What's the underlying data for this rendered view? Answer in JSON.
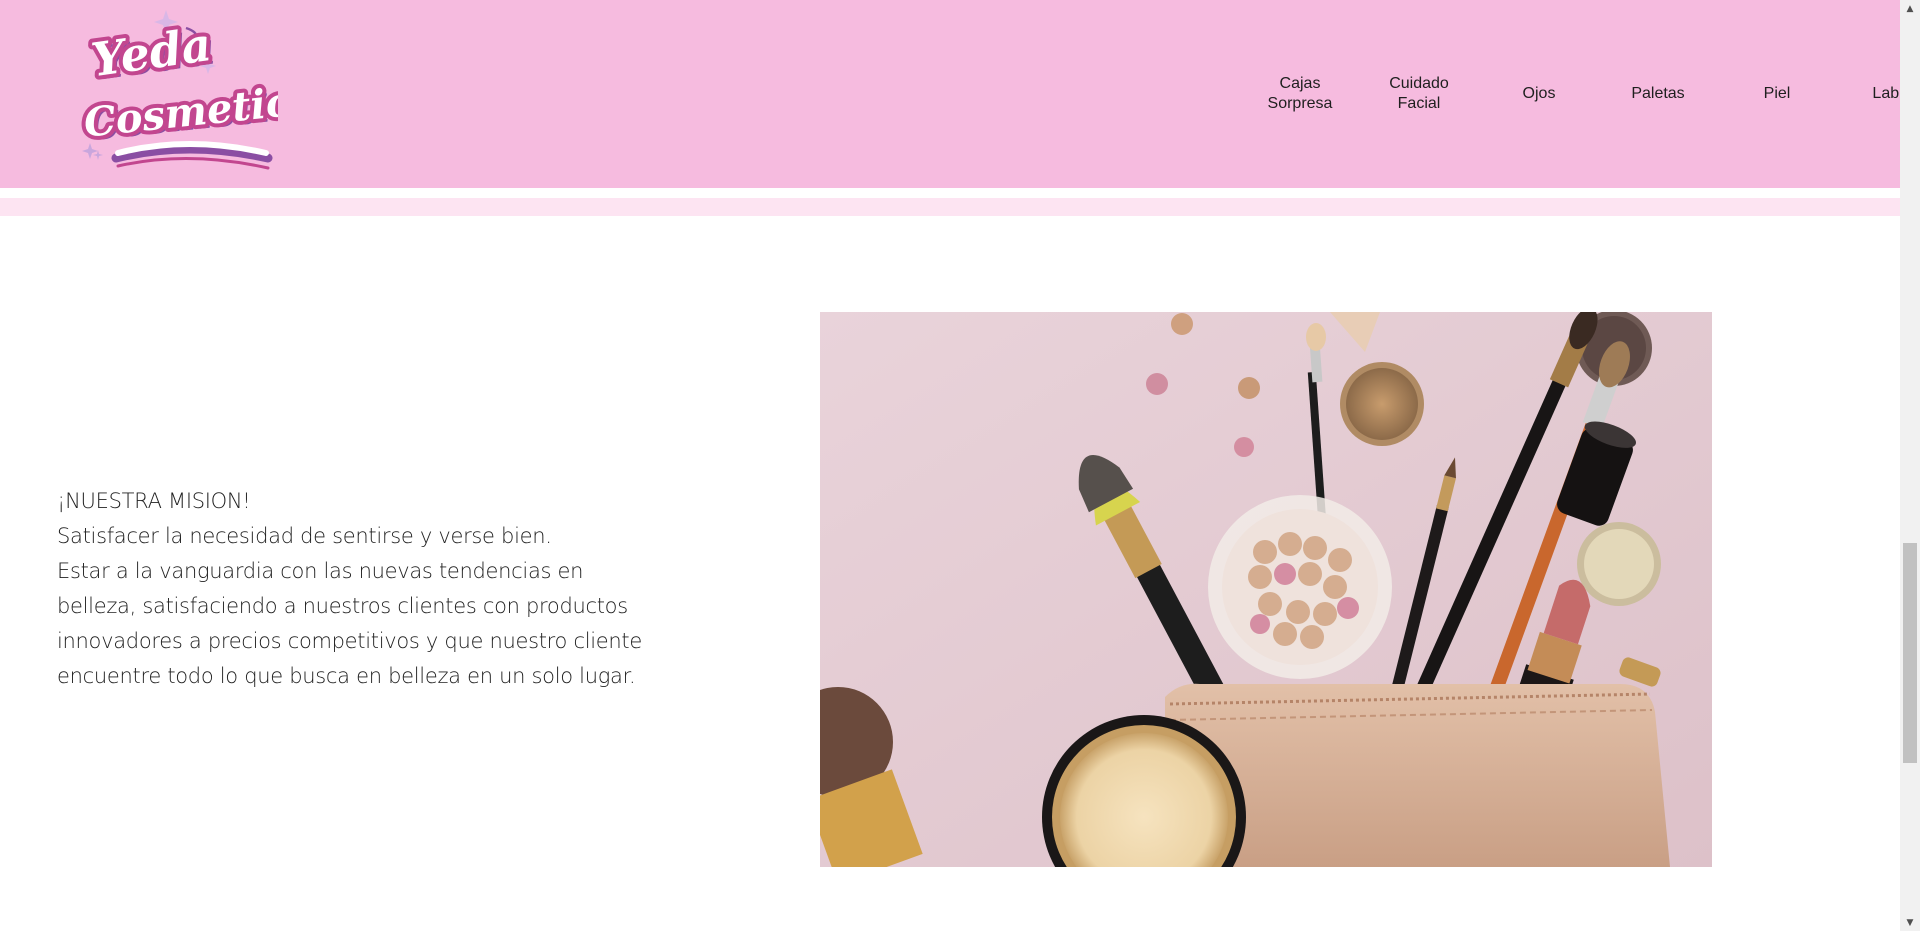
{
  "brand": {
    "logo_line1": "Yeda",
    "logo_line2": "Cosmetics"
  },
  "nav": {
    "items": [
      {
        "label": "Cajas Sorpresa",
        "lines": [
          "Cajas",
          "Sorpresa"
        ]
      },
      {
        "label": "Cuidado Facial",
        "lines": [
          "Cuidado",
          "Facial"
        ]
      },
      {
        "label": "Ojos"
      },
      {
        "label": "Paletas"
      },
      {
        "label": "Piel"
      },
      {
        "label": "Labios"
      }
    ]
  },
  "mission": {
    "heading": "¡NUESTRA MISION!",
    "lines": [
      "Satisfacer la necesidad de sentirse y verse bien.",
      "Estar a la vanguardia con las nuevas tendencias en",
      "belleza, satisfaciendo a nuestros clientes con productos",
      "innovadores a precios competitivos y que nuestro cliente",
      "encuentre todo lo que busca en belleza en un solo lugar."
    ]
  },
  "colors": {
    "header_bg": "#f6bbdf",
    "strip": "#fde4f2",
    "logo_magenta": "#c2468f",
    "logo_purple": "#8a4ea3"
  },
  "scrollbar": {
    "position_fraction": 0.58
  }
}
